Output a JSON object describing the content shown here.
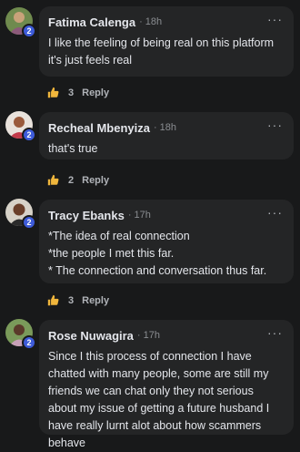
{
  "comments": [
    {
      "name": "Fatima Calenga",
      "time": "18h",
      "badge": "2",
      "text": "I like the feeling of being real on this platform it's just feels real",
      "likes": "3",
      "reply_label": "Reply"
    },
    {
      "name": "Recheal Mbenyiza",
      "time": "18h",
      "badge": "2",
      "text": "that's true",
      "likes": "2",
      "reply_label": "Reply"
    },
    {
      "name": "Tracy Ebanks",
      "time": "17h",
      "badge": "2",
      "text": "*The idea of real connection\n*the people I met this far.\n* The connection and conversation thus far.",
      "likes": "3",
      "reply_label": "Reply"
    },
    {
      "name": "Rose Nuwagira",
      "time": "17h",
      "badge": "2",
      "text": "Since I this process of connection I have chatted with many people, some are still my friends we can chat only they not serious about my issue of getting a future husband I have really lurnt alot about how scammers behave"
    }
  ],
  "separator": "·",
  "more_glyph": "···",
  "colors": {
    "background": "#18191a",
    "bubble": "#242526",
    "badge": "#3d5bd9",
    "like_icon": "#f0b63c"
  },
  "icons": {
    "like": "thumbs-up-icon",
    "more": "more-horizontal-icon"
  }
}
